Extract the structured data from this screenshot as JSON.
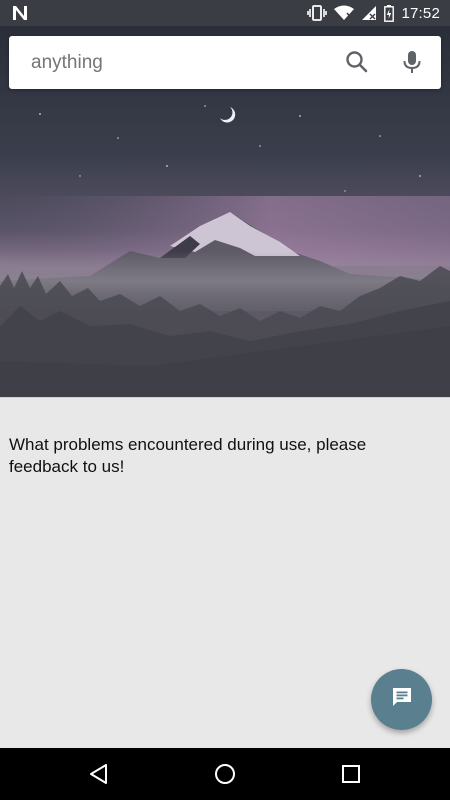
{
  "status_bar": {
    "time": "17:52",
    "left_icon": "n-notification-icon",
    "icons": [
      "vibrate-icon",
      "wifi-icon",
      "signal-icon",
      "battery-icon"
    ]
  },
  "search": {
    "placeholder": "anything",
    "value": "",
    "search_icon": "search-icon",
    "mic_icon": "mic-icon"
  },
  "main": {
    "feedback_text": "What problems encountered during use, please feedback to us!"
  },
  "fab": {
    "icon": "chat-icon",
    "color": "#5a7f8e"
  },
  "nav_bar": {
    "buttons": [
      "back-icon",
      "home-icon",
      "recents-icon"
    ]
  },
  "colors": {
    "status_bar": "#3a3d44",
    "content_bg": "#e8e8e8",
    "fab": "#5a7f8e"
  }
}
